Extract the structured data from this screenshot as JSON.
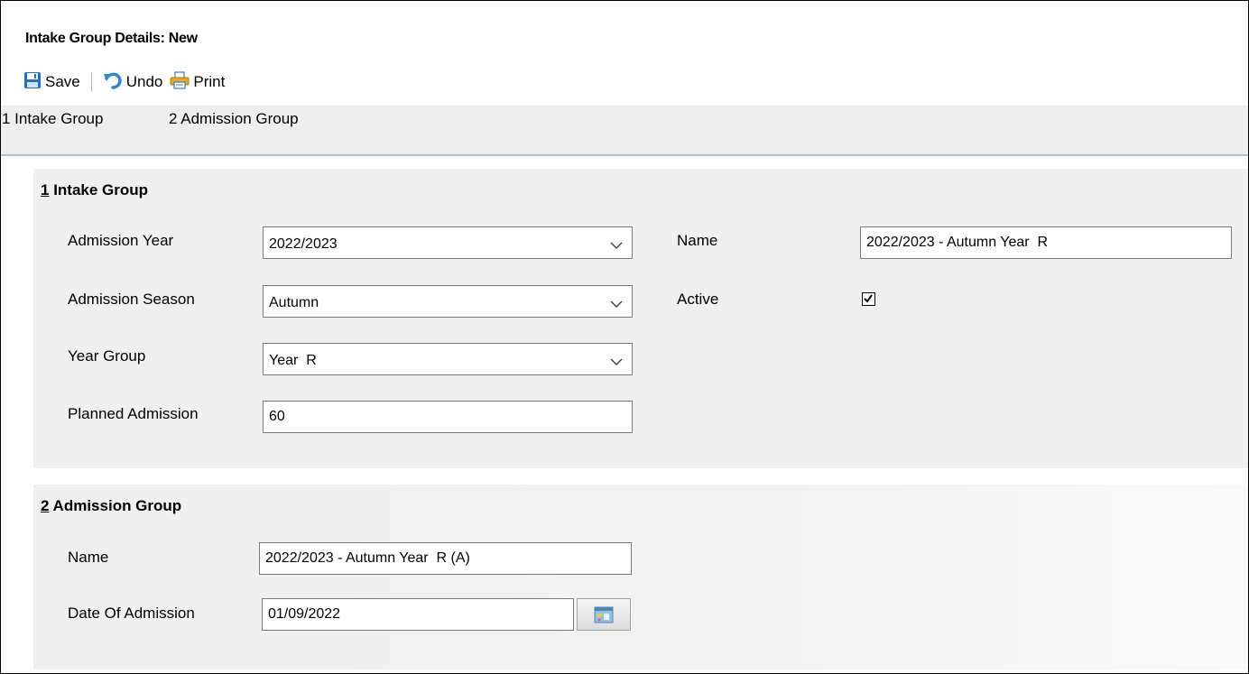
{
  "window": {
    "title": "Intake Group Details: New"
  },
  "toolbar": {
    "save_label": "Save",
    "undo_label": "Undo",
    "print_label": "Print"
  },
  "tabs": [
    {
      "label": "1 Intake Group"
    },
    {
      "label": "2 Admission Group"
    }
  ],
  "intake_group": {
    "section_number": "1",
    "section_title": " Intake Group",
    "admission_year": {
      "label": "Admission Year",
      "value": "2022/2023"
    },
    "admission_season": {
      "label": "Admission Season",
      "value": "Autumn"
    },
    "year_group": {
      "label": "Year Group",
      "value": "Year  R"
    },
    "planned_admission": {
      "label": "Planned Admission",
      "value": "60"
    },
    "name": {
      "label": "Name",
      "value": "2022/2023 - Autumn Year  R"
    },
    "active": {
      "label": "Active",
      "checked": true
    }
  },
  "admission_group": {
    "section_number": "2",
    "section_title": " Admission Group",
    "name": {
      "label": "Name",
      "value": "2022/2023 - Autumn Year  R (A)"
    },
    "date_of_admission": {
      "label": "Date Of Admission",
      "value": "01/09/2022"
    }
  },
  "icons": {
    "save": "floppy-disk-icon",
    "undo": "undo-arrow-icon",
    "print": "printer-icon",
    "dropdown": "chevron-down-icon",
    "check": "check-icon",
    "calendar": "calendar-icon"
  },
  "colors": {
    "panel_bg": "#f0f0f0",
    "tab_strip_bg": "#eeeeee",
    "tab_strip_border": "#a7bfd9",
    "save_icon": "#1e73c9",
    "undo_icon": "#2a86d6",
    "print_icon": "#e9a81c"
  }
}
